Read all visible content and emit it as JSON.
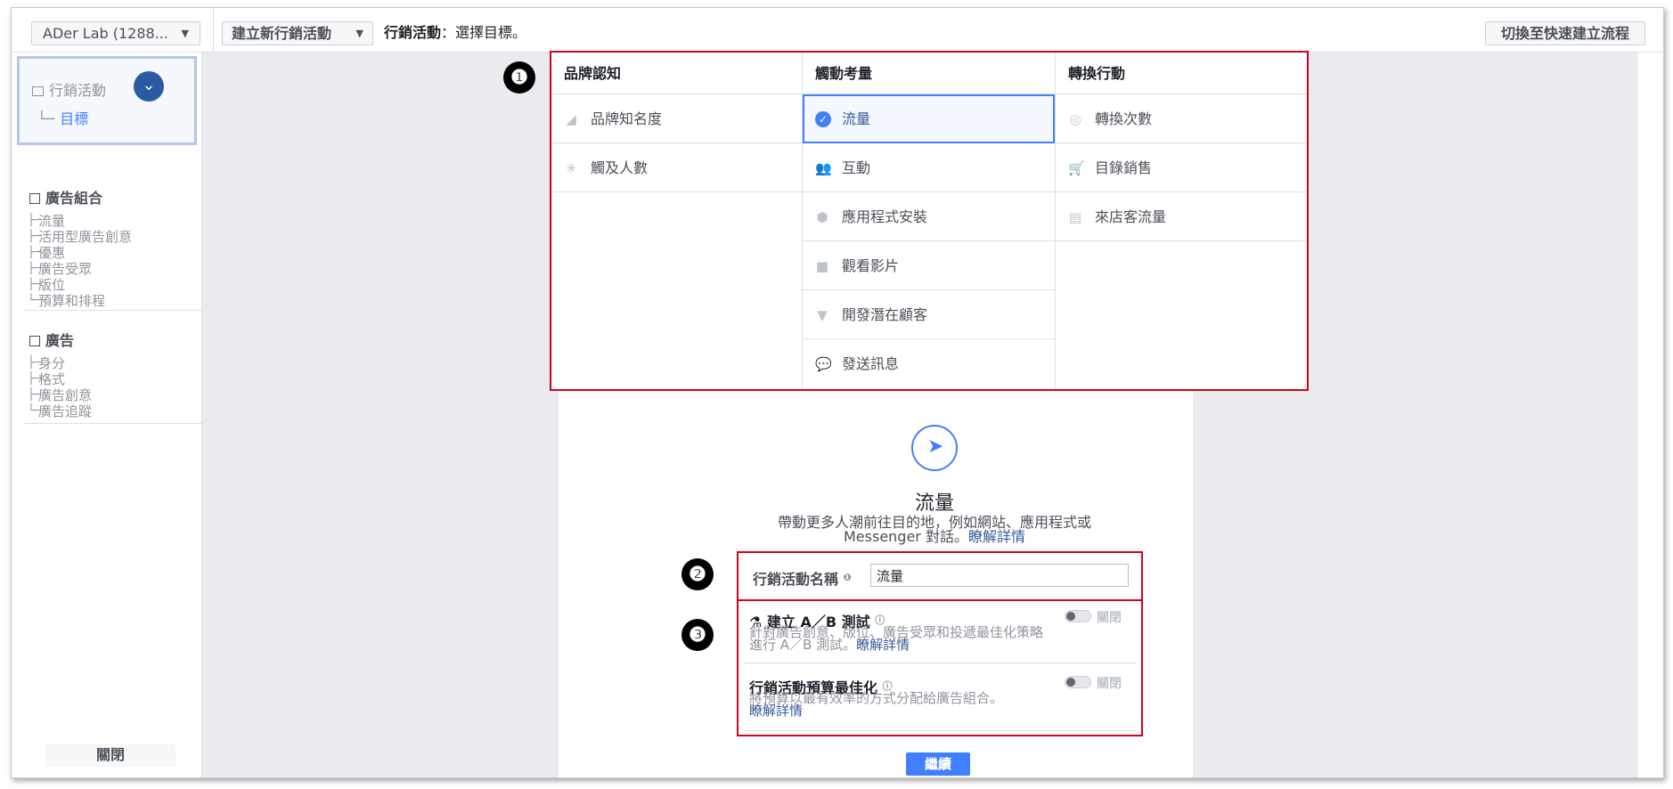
{
  "topbar": {
    "account": "ADer Lab (1288...",
    "new_campaign": "建立新行銷活動",
    "breadcrumb_bold": "行銷活動",
    "breadcrumb_rest": "：選擇目標。",
    "quick_flow": "切換至快速建立流程"
  },
  "sidebar": {
    "campaign_title": "行銷活動",
    "campaign_sub": "目標",
    "adset": {
      "title": "廣告組合",
      "items": [
        "流量",
        "活用型廣告創意",
        "優惠",
        "廣告受眾",
        "版位",
        "預算和排程"
      ]
    },
    "ad": {
      "title": "廣告",
      "items": [
        "身分",
        "格式",
        "廣告創意",
        "廣告追蹤"
      ]
    },
    "close": "關閉"
  },
  "objectives": {
    "columns": [
      {
        "header": "品牌認知",
        "items": [
          {
            "label": "品牌知名度",
            "icon": "megaphone-icon",
            "glyph": "◢"
          },
          {
            "label": "觸及人數",
            "icon": "reach-icon",
            "glyph": "✳"
          }
        ]
      },
      {
        "header": "觸動考量",
        "items": [
          {
            "label": "流量",
            "icon": "check-icon",
            "glyph": "✓",
            "selected": true
          },
          {
            "label": "互動",
            "icon": "people-icon",
            "glyph": "👥"
          },
          {
            "label": "應用程式安裝",
            "icon": "box-icon",
            "glyph": "⬢"
          },
          {
            "label": "觀看影片",
            "icon": "video-icon",
            "glyph": "■"
          },
          {
            "label": "開發潛在顧客",
            "icon": "funnel-icon",
            "glyph": "▼"
          },
          {
            "label": "發送訊息",
            "icon": "chat-icon",
            "glyph": "💬"
          }
        ]
      },
      {
        "header": "轉換行動",
        "items": [
          {
            "label": "轉換次數",
            "icon": "globe-icon",
            "glyph": "◎"
          },
          {
            "label": "目錄銷售",
            "icon": "cart-icon",
            "glyph": "🛒"
          },
          {
            "label": "來店客流量",
            "icon": "store-icon",
            "glyph": "▤"
          }
        ]
      }
    ]
  },
  "markers": {
    "one": "❶",
    "two": "❷",
    "three": "❸"
  },
  "detail": {
    "title": "流量",
    "body": "帶動更多人潮前往目的地，例如網站、應用程式或 Messenger 對話。",
    "learn_more": "瞭解詳情"
  },
  "name_field": {
    "label": "行銷活動名稱",
    "value": "流量"
  },
  "options": {
    "ab_test": {
      "title": "建立 A／B 測試",
      "desc": "針對廣告創意、版位、廣告受眾和投遞最佳化策略進行 A／B 測試。",
      "link": "瞭解詳情",
      "toggle": "關閉"
    },
    "budget": {
      "title": "行銷活動預算最佳化",
      "desc": "將預算以最有效率的方式分配給廣告組合。",
      "link": "瞭解詳情",
      "toggle": "關閉"
    }
  },
  "continue_button": "繼續",
  "colors": {
    "accent": "#4080ff",
    "highlight_border": "#d0021b",
    "selected_bg": "#f5f8ff",
    "link": "#365899"
  }
}
